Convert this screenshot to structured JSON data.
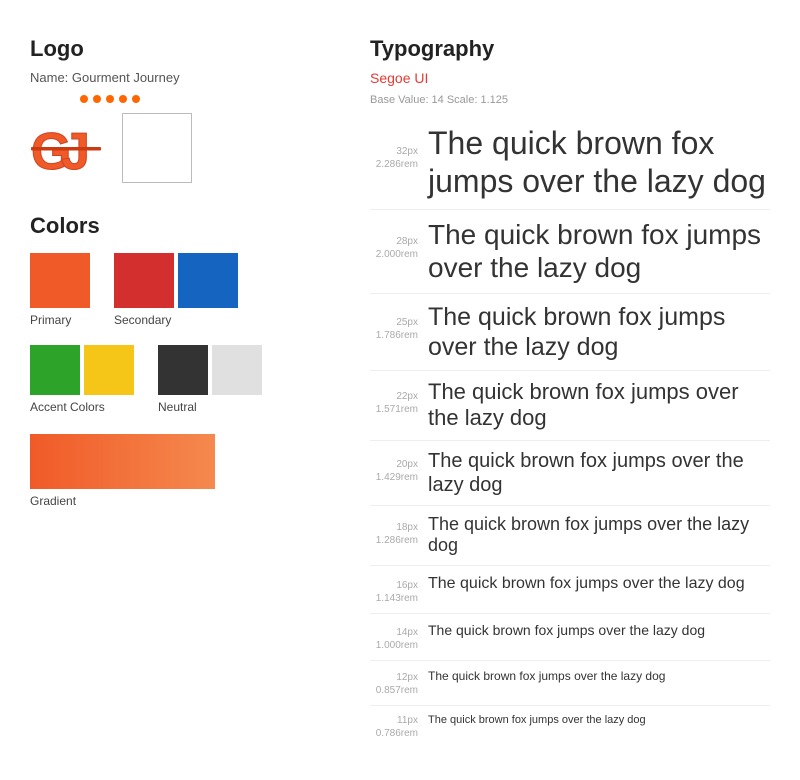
{
  "left": {
    "logo_section": {
      "title": "Logo",
      "name_label": "Name: Gourment Journey",
      "dots": [
        "dot",
        "dot",
        "dot",
        "dot",
        "dot"
      ]
    },
    "colors_section": {
      "title": "Colors",
      "primary_label": "Primary",
      "secondary_label": "Secondary",
      "accent_label": "Accent Colors",
      "neutral_label": "Neutral",
      "gradient_label": "Gradient"
    }
  },
  "right": {
    "typography_section": {
      "title": "Typography",
      "font_name": "Segoe UI",
      "meta": "Base Value: 14   Scale: 1.125",
      "sizes": [
        {
          "px": "32px",
          "rem": "2.286rem",
          "text": "The quick brown fox jumps over the lazy dog",
          "size_num": 32
        },
        {
          "px": "28px",
          "rem": "2.000rem",
          "text": "The quick brown fox jumps over the lazy dog",
          "size_num": 28
        },
        {
          "px": "25px",
          "rem": "1.786rem",
          "text": "The quick brown fox jumps over the lazy dog",
          "size_num": 25
        },
        {
          "px": "22px",
          "rem": "1.571rem",
          "text": "The quick brown fox jumps over the lazy dog",
          "size_num": 22
        },
        {
          "px": "20px",
          "rem": "1.429rem",
          "text": "The quick brown fox jumps over the lazy dog",
          "size_num": 20
        },
        {
          "px": "18px",
          "rem": "1.286rem",
          "text": "The quick brown fox jumps over the lazy dog",
          "size_num": 18
        },
        {
          "px": "16px",
          "rem": "1.143rem",
          "text": "The quick brown fox jumps over the lazy dog",
          "size_num": 16
        },
        {
          "px": "14px",
          "rem": "1.000rem",
          "text": "The quick brown fox jumps over the lazy dog",
          "size_num": 14
        },
        {
          "px": "12px",
          "rem": "0.857rem",
          "text": "The quick brown fox jumps over the lazy dog",
          "size_num": 12
        },
        {
          "px": "11px",
          "rem": "0.786rem",
          "text": "The quick brown fox jumps over the lazy dog",
          "size_num": 11
        }
      ]
    }
  }
}
